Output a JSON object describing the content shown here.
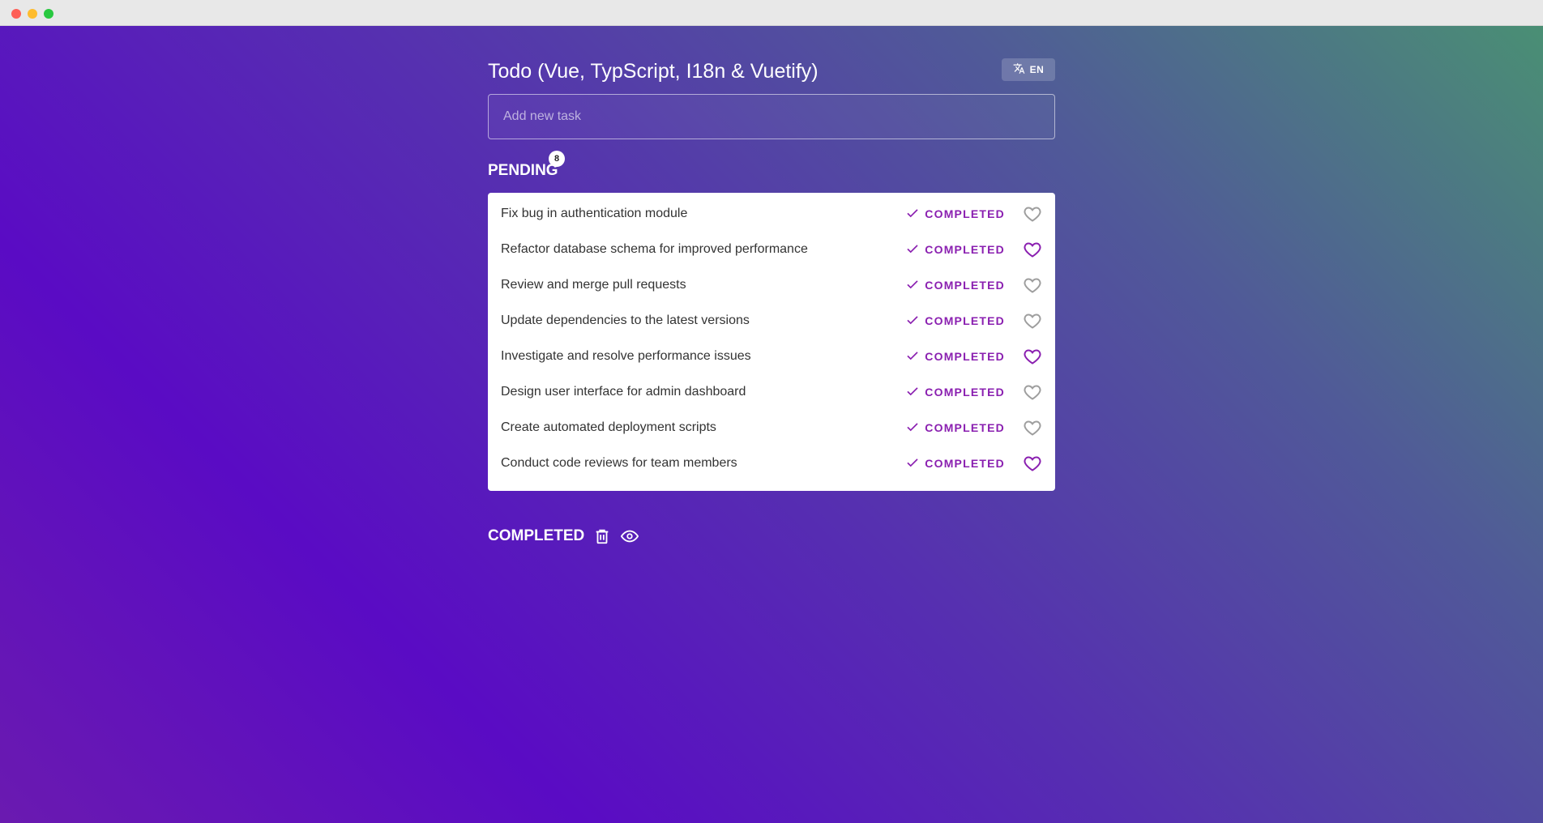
{
  "app": {
    "title": "Todo (Vue, TypScript, I18n & Vuetify)"
  },
  "language": {
    "label": "EN",
    "icon": "translate-icon"
  },
  "new_task": {
    "placeholder": "Add new task",
    "value": ""
  },
  "pending": {
    "title": "PENDING",
    "count": "8",
    "tasks": [
      {
        "text": "Fix bug in authentication module",
        "action": "COMPLETED",
        "favorite": false
      },
      {
        "text": "Refactor database schema for improved performance",
        "action": "COMPLETED",
        "favorite": true
      },
      {
        "text": "Review and merge pull requests",
        "action": "COMPLETED",
        "favorite": false
      },
      {
        "text": "Update dependencies to the latest versions",
        "action": "COMPLETED",
        "favorite": false
      },
      {
        "text": "Investigate and resolve performance issues",
        "action": "COMPLETED",
        "favorite": true
      },
      {
        "text": "Design user interface for admin dashboard",
        "action": "COMPLETED",
        "favorite": false
      },
      {
        "text": "Create automated deployment scripts",
        "action": "COMPLETED",
        "favorite": false
      },
      {
        "text": "Conduct code reviews for team members",
        "action": "COMPLETED",
        "favorite": true
      }
    ]
  },
  "completed": {
    "title": "COMPLETED",
    "delete_icon": "trash-icon",
    "toggle_icon": "eye-icon"
  },
  "colors": {
    "accent": "#8a1fb0",
    "favorite_off": "#9e9e9e",
    "text": "#333333"
  }
}
